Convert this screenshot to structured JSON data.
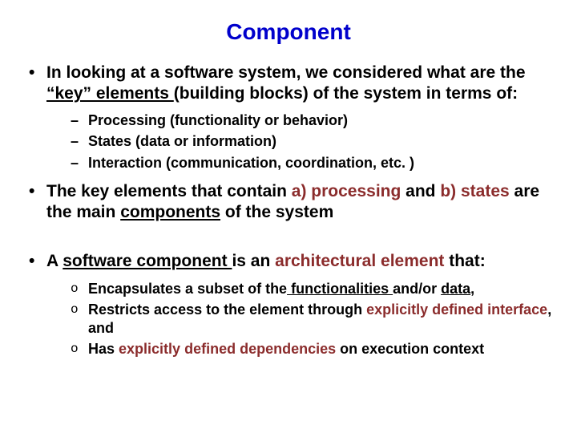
{
  "title": "Component",
  "b1_pre": "In looking at a software system, we considered what are the ",
  "b1_key": "“key” elements ",
  "b1_post": "(building blocks) of the system in terms of:",
  "s1a": "Processing (functionality or behavior)",
  "s1b": "States (data or information)",
  "s1c": "Interaction (communication, coordination, etc. )",
  "b2_a": "The key elements that contain ",
  "b2_b": "a) processing",
  "b2_c": " and ",
  "b2_d": "b) states",
  "b2_e": " are the main ",
  "b2_f": "components",
  "b2_g": " of the system",
  "b3_a": "A ",
  "b3_b": "software component ",
  "b3_c": "is an ",
  "b3_d": "architectural element",
  "b3_e": " that:",
  "s3a_a": "Encapsulates a subset of the",
  "s3a_b": " functionalities ",
  "s3a_c": "and/or ",
  "s3a_d": "data",
  "s3a_e": ",",
  "s3b_a": "Restricts access to the element through ",
  "s3b_b": "explicitly defined interface",
  "s3b_c": ", and",
  "s3c_a": "Has ",
  "s3c_b": "explicitly defined dependencies",
  "s3c_c": " on execution context"
}
